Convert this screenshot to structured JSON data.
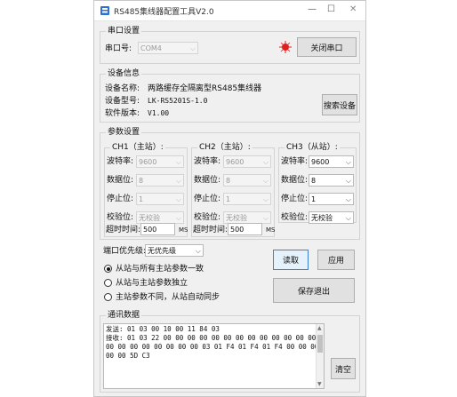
{
  "window": {
    "title": "RS485集线器配置工具V2.0",
    "minimize_glyph": "—",
    "maximize_glyph": "☐",
    "close_glyph": "✕"
  },
  "serial": {
    "group_title": "串口设置",
    "port_label": "串口号:",
    "port_value": "COM4",
    "indicator_color": "#e02020",
    "toggle_button": "关闭串口"
  },
  "device": {
    "group_title": "设备信息",
    "name_label": "设备名称:",
    "name_value": "两路缓存全隔离型RS485集线器",
    "model_label": "设备型号:",
    "model_value": "LK-RS5201S-1.0",
    "version_label": "软件版本:",
    "version_value": "V1.00",
    "search_button": "搜索设备"
  },
  "params": {
    "group_title": "参数设置",
    "baud_label": "波特率:",
    "data_label": "数据位:",
    "stop_label": "停止位:",
    "parity_label": "校验位:",
    "timeout_label": "超时时间:",
    "ms_unit": "MS",
    "channels": [
      {
        "title": "CH1（主站）:",
        "baud": "9600",
        "data": "8",
        "stop": "1",
        "parity": "无校验",
        "timeout": "500",
        "enabled": false
      },
      {
        "title": "CH2（主站）:",
        "baud": "9600",
        "data": "8",
        "stop": "1",
        "parity": "无校验",
        "timeout": "500",
        "enabled": false
      },
      {
        "title": "CH3（从站）:",
        "baud": "9600",
        "data": "8",
        "stop": "1",
        "parity": "无校验",
        "enabled": true
      }
    ]
  },
  "priority": {
    "label": "端口优先级:",
    "value": "无优先级"
  },
  "modes": [
    {
      "label": "从站与所有主站参数一致",
      "checked": true
    },
    {
      "label": "从站与主站参数独立",
      "checked": false
    },
    {
      "label": "主站参数不同，从站自动同步",
      "checked": false
    }
  ],
  "actions": {
    "read": "读取",
    "apply": "应用",
    "save_exit": "保存退出"
  },
  "comm": {
    "group_title": "通讯数据",
    "lines": [
      "发送: 01 03 00 10 00 11 84 03",
      "接收: 01 03 22 00 00 00 00 00 00 00 00 00 00 00 00 00",
      "00 00 00 00 00 00 00 00 03 01 F4 01 F4 01 F4 00 00 00",
      "00 00 5D C3"
    ],
    "clear_button": "清空"
  }
}
